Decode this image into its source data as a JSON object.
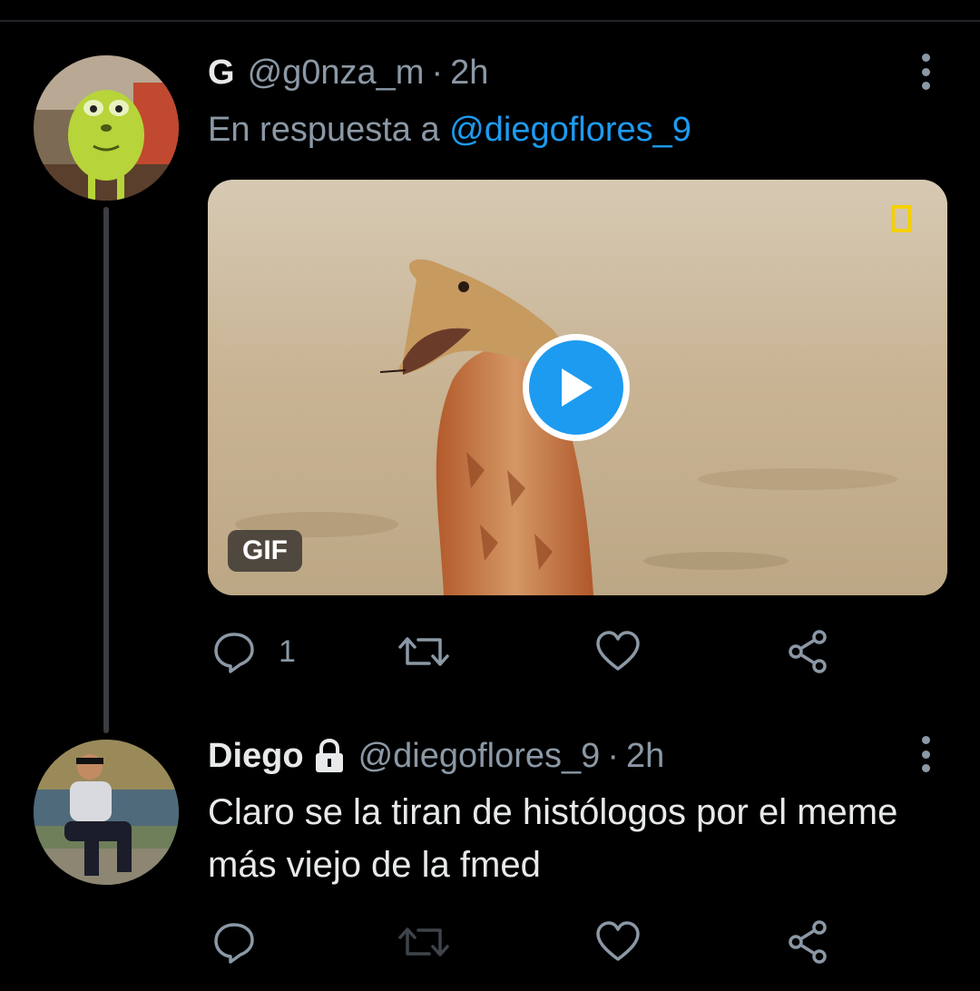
{
  "tweet1": {
    "name": "G",
    "handle": "@g0nza_m",
    "separator": "·",
    "time": "2h",
    "reply_prefix": "En respuesta a",
    "reply_handle": "@diegoflores_9",
    "media_badge": "GIF",
    "reply_count": "1"
  },
  "tweet2": {
    "name": "Diego",
    "handle": "@diegoflores_9",
    "separator": "·",
    "time": "2h",
    "text": "Claro se la tiran de histólogos por el meme más viejo de la fmed"
  },
  "icons": {
    "reply": "reply-icon",
    "retweet": "retweet-icon",
    "like": "heart-icon",
    "share": "share-icon",
    "more": "more-options-icon",
    "lock": "lock-icon",
    "play": "play-icon"
  },
  "colors": {
    "background": "#000000",
    "text": "#e7e9ea",
    "muted": "#8b98a5",
    "link": "#1d9bf0",
    "thread_line": "#3a3d41"
  }
}
